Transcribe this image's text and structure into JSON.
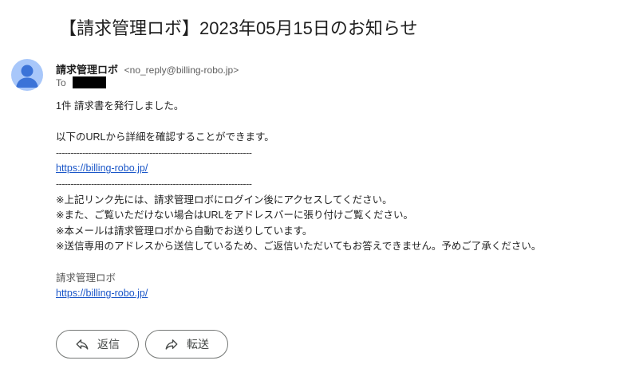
{
  "email": {
    "subject": "【請求管理ロボ】2023年05月15日のお知らせ",
    "sender_name": "請求管理ロボ",
    "sender_email": "<no_reply@billing-robo.jp>",
    "to_label": "To",
    "body": {
      "line1": "1件 請求書を発行しました。",
      "line2": "以下のURLから詳細を確認することができます。",
      "separator1": "-------------------------------------------------------------------",
      "url": "https://billing-robo.jp/",
      "separator2": "-------------------------------------------------------------------",
      "notes": [
        "※上記リンク先には、請求管理ロボにログイン後にアクセスしてください。",
        "※また、ご覧いただけない場合はURLをアドレスバーに張り付けご覧ください。",
        "※本メールは請求管理ロボから自動でお送りしています。",
        "※送信専用のアドレスから送信しているため、ご返信いただいてもお答えできません。予めご了承ください。"
      ],
      "signature_name": "請求管理ロボ",
      "signature_url": "https://billing-robo.jp/"
    }
  },
  "actions": {
    "reply_label": "返信",
    "reply_icon": "reply-icon",
    "forward_label": "転送",
    "forward_icon": "forward-icon"
  },
  "colors": {
    "link": "#1a56c8",
    "avatar_bg": "#a8c7fa",
    "avatar_fg": "#3b73d8"
  }
}
